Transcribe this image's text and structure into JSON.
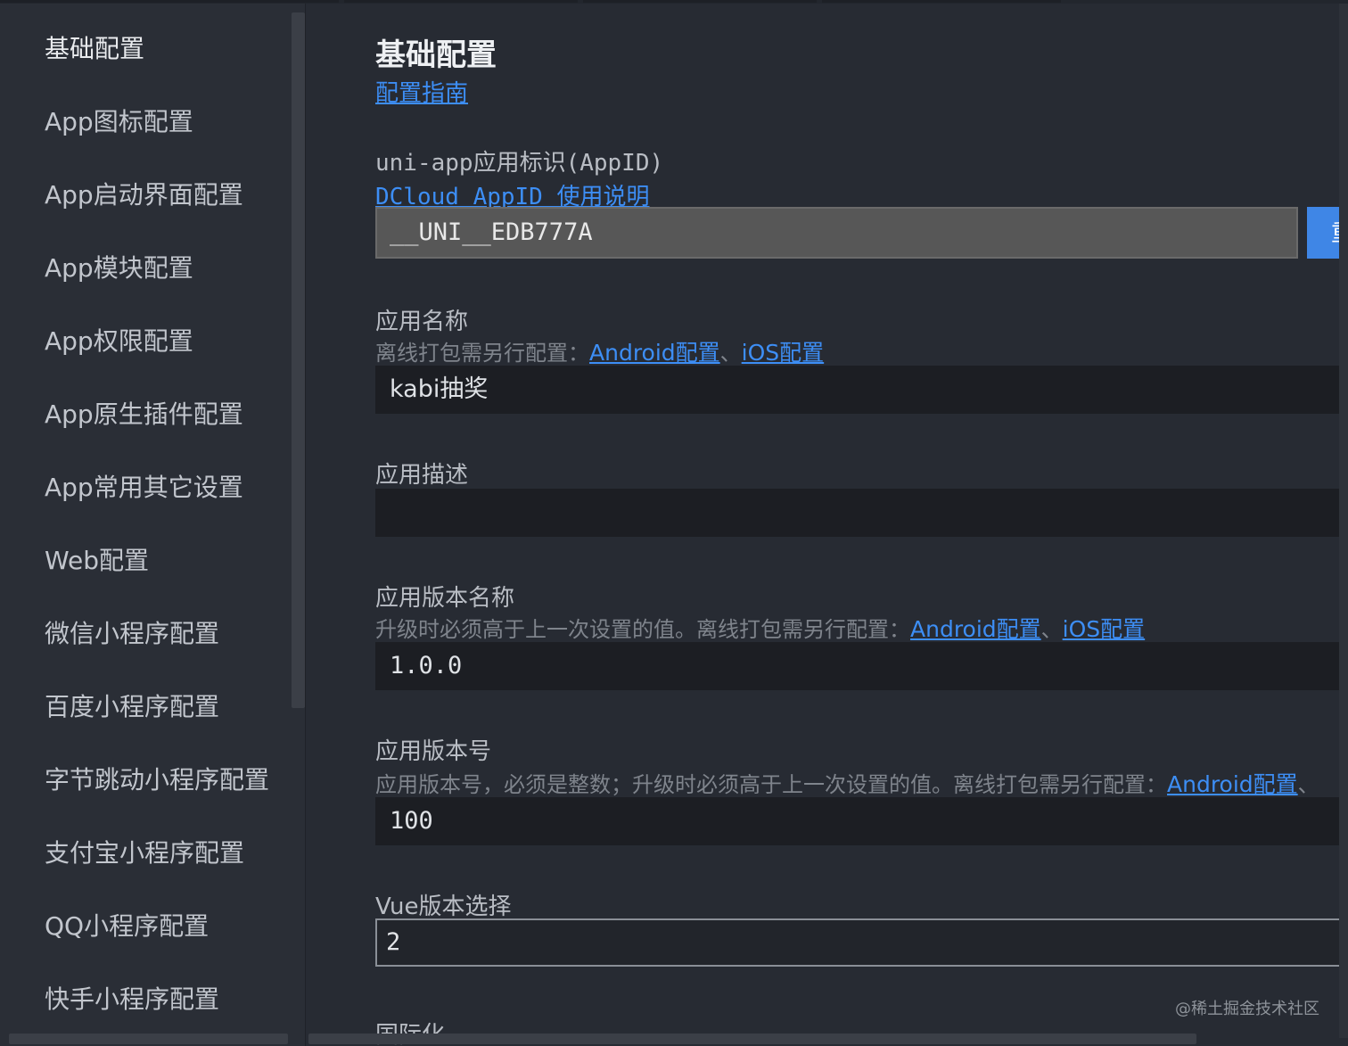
{
  "sidebar": {
    "items": [
      {
        "label": "基础配置"
      },
      {
        "label": "App图标配置"
      },
      {
        "label": "App启动界面配置"
      },
      {
        "label": "App模块配置"
      },
      {
        "label": "App权限配置"
      },
      {
        "label": "App原生插件配置"
      },
      {
        "label": "App常用其它设置"
      },
      {
        "label": "Web配置"
      },
      {
        "label": "微信小程序配置"
      },
      {
        "label": "百度小程序配置"
      },
      {
        "label": "字节跳动小程序配置"
      },
      {
        "label": "支付宝小程序配置"
      },
      {
        "label": "QQ小程序配置"
      },
      {
        "label": "快手小程序配置"
      }
    ]
  },
  "main": {
    "title": "基础配置",
    "guide_link": "配置指南",
    "appid": {
      "label": "uni-app应用标识(AppID)",
      "help_link": "DCloud AppID 使用说明",
      "value": "__UNI__EDB777A",
      "button_label": "重"
    },
    "app_name": {
      "label": "应用名称",
      "hint": "离线打包需另行配置：",
      "android_link": "Android配置",
      "sep": "、",
      "ios_link": "iOS配置",
      "value": "kabi抽奖"
    },
    "app_desc": {
      "label": "应用描述",
      "value": ""
    },
    "version_name": {
      "label": "应用版本名称",
      "hint": "升级时必须高于上一次设置的值。离线打包需另行配置：",
      "android_link": "Android配置",
      "sep": "、",
      "ios_link": "iOS配置",
      "value": "1.0.0"
    },
    "version_code": {
      "label": "应用版本号",
      "hint": "应用版本号，必须是整数；升级时必须高于上一次设置的值。离线打包需另行配置：",
      "android_link": "Android配置",
      "sep": "、",
      "value": "100"
    },
    "vue_version": {
      "label": "Vue版本选择",
      "value": "2"
    },
    "next_section_label": "国际化"
  },
  "watermark": "@稀土掘金技术社区"
}
